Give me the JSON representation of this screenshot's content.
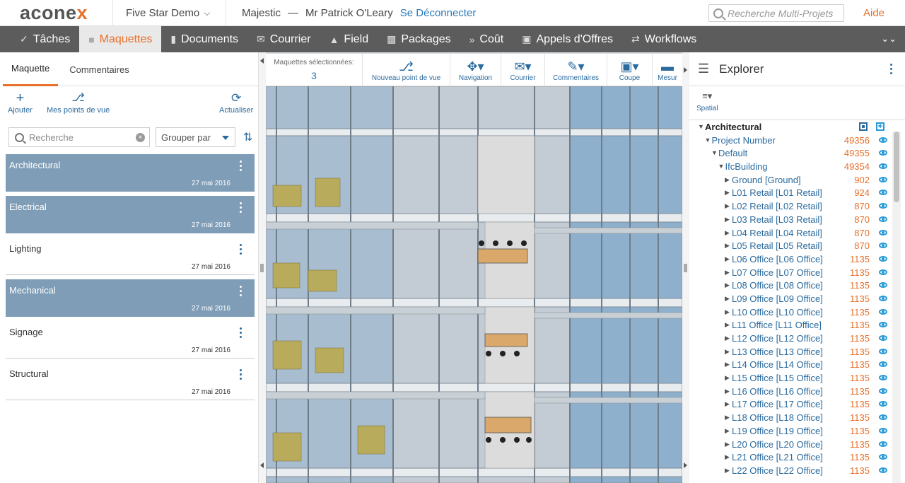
{
  "header": {
    "logo_main": "acone",
    "logo_accent": "x",
    "project": "Five Star Demo",
    "org": "Majestic",
    "separator": "—",
    "user": "Mr Patrick O'Leary",
    "logout": "Se Déconnecter",
    "search_placeholder": "Recherche Multi-Projets",
    "help": "Aide"
  },
  "nav": {
    "items": [
      {
        "label": "Tâches",
        "icon": "check-icon"
      },
      {
        "label": "Maquettes",
        "icon": "cube-icon"
      },
      {
        "label": "Documents",
        "icon": "document-icon"
      },
      {
        "label": "Courrier",
        "icon": "mail-icon"
      },
      {
        "label": "Field",
        "icon": "warning-icon"
      },
      {
        "label": "Packages",
        "icon": "packages-icon"
      },
      {
        "label": "Coût",
        "icon": "cost-icon"
      },
      {
        "label": "Appels d'Offres",
        "icon": "tender-icon"
      },
      {
        "label": "Workflows",
        "icon": "workflow-icon"
      }
    ],
    "active": "Maquettes"
  },
  "left": {
    "tabs": [
      "Maquette",
      "Commentaires"
    ],
    "actions": {
      "add": "Ajouter",
      "views": "Mes points de vue",
      "refresh": "Actualiser"
    },
    "search_placeholder": "Recherche",
    "group_by": "Grouper par",
    "models": [
      {
        "name": "Architectural",
        "date": "27 mai 2016",
        "selected": true
      },
      {
        "name": "Electrical",
        "date": "27 mai 2016",
        "selected": true
      },
      {
        "name": "Lighting",
        "date": "27 mai 2016",
        "selected": false
      },
      {
        "name": "Mechanical",
        "date": "27 mai 2016",
        "selected": true
      },
      {
        "name": "Signage",
        "date": "27 mai 2016",
        "selected": false
      },
      {
        "name": "Structural",
        "date": "27 mai 2016",
        "selected": false
      }
    ]
  },
  "viewer": {
    "selected_label": "Maquettes sélectionnées:",
    "selected_count": "3",
    "tools": [
      "Nouveau point de vue",
      "Navigation",
      "Courrier",
      "Commentaires",
      "Coupe",
      "Mesur"
    ]
  },
  "explorer": {
    "title": "Explorer",
    "mode": "Spatial",
    "tree": [
      {
        "label": "Architectural",
        "count": "",
        "level": 0,
        "bold": true
      },
      {
        "label": "Project Number",
        "count": "49356",
        "level": 1
      },
      {
        "label": "Default",
        "count": "49355",
        "level": 2
      },
      {
        "label": "IfcBuilding",
        "count": "49354",
        "level": 3
      },
      {
        "label": "Ground [Ground]",
        "count": "902",
        "level": 4
      },
      {
        "label": "L01 Retail [L01 Retail]",
        "count": "924",
        "level": 4
      },
      {
        "label": "L02 Retail [L02 Retail]",
        "count": "870",
        "level": 4
      },
      {
        "label": "L03 Retail [L03 Retail]",
        "count": "870",
        "level": 4
      },
      {
        "label": "L04 Retail [L04 Retail]",
        "count": "870",
        "level": 4
      },
      {
        "label": "L05 Retail [L05 Retail]",
        "count": "870",
        "level": 4
      },
      {
        "label": "L06 Office [L06 Office]",
        "count": "1135",
        "level": 4
      },
      {
        "label": "L07 Office [L07 Office]",
        "count": "1135",
        "level": 4
      },
      {
        "label": "L08 Office [L08 Office]",
        "count": "1135",
        "level": 4
      },
      {
        "label": "L09 Office [L09 Office]",
        "count": "1135",
        "level": 4
      },
      {
        "label": "L10 Office [L10 Office]",
        "count": "1135",
        "level": 4
      },
      {
        "label": "L11 Office [L11 Office]",
        "count": "1135",
        "level": 4
      },
      {
        "label": "L12 Office [L12 Office]",
        "count": "1135",
        "level": 4
      },
      {
        "label": "L13 Office [L13 Office]",
        "count": "1135",
        "level": 4
      },
      {
        "label": "L14 Office [L14 Office]",
        "count": "1135",
        "level": 4
      },
      {
        "label": "L15 Office [L15 Office]",
        "count": "1135",
        "level": 4
      },
      {
        "label": "L16 Office [L16 Office]",
        "count": "1135",
        "level": 4
      },
      {
        "label": "L17 Office [L17 Office]",
        "count": "1135",
        "level": 4
      },
      {
        "label": "L18 Office [L18 Office]",
        "count": "1135",
        "level": 4
      },
      {
        "label": "L19 Office [L19 Office]",
        "count": "1135",
        "level": 4
      },
      {
        "label": "L20 Office [L20 Office]",
        "count": "1135",
        "level": 4
      },
      {
        "label": "L21 Office [L21 Office]",
        "count": "1135",
        "level": 4
      },
      {
        "label": "L22 Office [L22 Office]",
        "count": "1135",
        "level": 4
      }
    ]
  },
  "colors": {
    "accent": "#e8702a",
    "link": "#2a6a9e",
    "selected": "#7f9db6",
    "nav": "#5c5c5c"
  }
}
